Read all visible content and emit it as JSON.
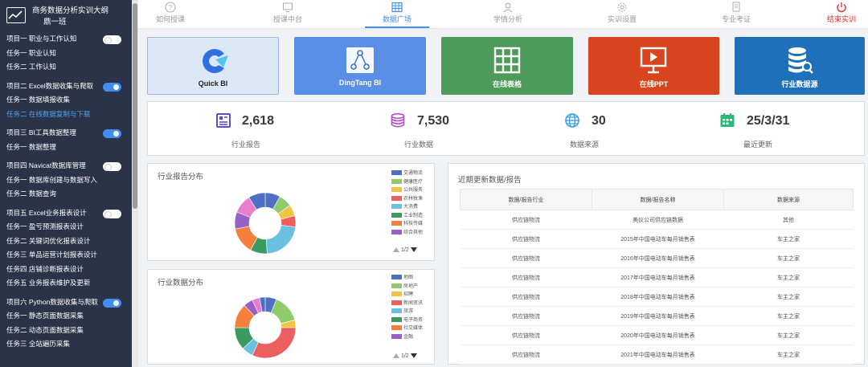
{
  "sidebar": {
    "title_line1": "商务数据分析实训大纲",
    "title_line2": "鼎一班",
    "projects": [
      {
        "label": "项目一 职业与工作认知",
        "on": false,
        "tasks": [
          {
            "label": "任务一 职业认知"
          },
          {
            "label": "任务二 工作认知"
          }
        ]
      },
      {
        "label": "项目二 Excel数据收集与爬取",
        "on": true,
        "tasks": [
          {
            "label": "任务一 数据填报收集"
          },
          {
            "label": "任务二 在线数据复制与下载",
            "active": true
          }
        ]
      },
      {
        "label": "项目三 BI工具数据整理",
        "on": true,
        "tasks": [
          {
            "label": "任务一 数据整理"
          }
        ]
      },
      {
        "label": "项目四 Navicat数据库管理",
        "on": false,
        "tasks": [
          {
            "label": "任务一 数据库创建与数据写入"
          },
          {
            "label": "任务二 数据查询"
          }
        ]
      },
      {
        "label": "项目五 Excel业务报表设计",
        "on": false,
        "tasks": [
          {
            "label": "任务一 盈亏预测报表设计"
          },
          {
            "label": "任务二 关键词优化报表设计"
          },
          {
            "label": "任务三 单品运营计划报表设计"
          },
          {
            "label": "任务四 店铺诊断报表设计"
          },
          {
            "label": "任务五 业务报表维护及更新"
          }
        ]
      },
      {
        "label": "项目六 Python数据收集与爬取",
        "on": true,
        "tasks": [
          {
            "label": "任务一 静态页面数据采集"
          },
          {
            "label": "任务二 动态页面数据采集"
          },
          {
            "label": "任务三 全站遍历采集"
          }
        ]
      }
    ]
  },
  "nav": {
    "tabs": [
      {
        "label": "如何授课",
        "icon": "question-circle-icon"
      },
      {
        "label": "授课中台",
        "icon": "monitor-icon"
      },
      {
        "label": "数据广场",
        "icon": "grid-table-icon",
        "active": true
      },
      {
        "label": "学情分析",
        "icon": "user-analysis-icon"
      },
      {
        "label": "实训设置",
        "icon": "gear-icon"
      },
      {
        "label": "专业考证",
        "icon": "certificate-icon"
      }
    ],
    "end_label": "结束实训"
  },
  "tiles": [
    {
      "label": "Quick BI",
      "color": "#dde8f7",
      "icon": "quickbi-logo-icon"
    },
    {
      "label": "DingTang BI",
      "color": "#5a8fe8",
      "icon": "share-nodes-icon"
    },
    {
      "label": "在线表格",
      "color": "#4d9a5a",
      "icon": "table-icon"
    },
    {
      "label": "在线PPT",
      "color": "#d9451e",
      "icon": "presentation-icon"
    },
    {
      "label": "行业数据源",
      "color": "#1e70b8",
      "icon": "database-search-icon"
    }
  ],
  "stats": [
    {
      "value": "2,618",
      "label": "行业报告",
      "color": "#5a4fcf",
      "icon": "report-icon"
    },
    {
      "value": "7,530",
      "label": "行业数据",
      "color": "#b24fc9",
      "icon": "database-icon"
    },
    {
      "value": "30",
      "label": "数据来源",
      "color": "#3aa0e0",
      "icon": "globe-icon"
    },
    {
      "value": "25/3/31",
      "label": "最近更新",
      "color": "#2db87a",
      "icon": "calendar-icon"
    }
  ],
  "report_dist": {
    "title": "行业报告分布",
    "pager": "1/2",
    "legend": [
      {
        "label": "交通物流",
        "color": "#4e6fc4"
      },
      {
        "label": "健康医疗",
        "color": "#8fcb6b"
      },
      {
        "label": "公共服务",
        "color": "#f5c342"
      },
      {
        "label": "农林牧渔",
        "color": "#ec5f5f"
      },
      {
        "label": "大消费",
        "color": "#6ac0e0"
      },
      {
        "label": "工业制造",
        "color": "#3a9a60"
      },
      {
        "label": "科技传媒",
        "color": "#f57f3c"
      },
      {
        "label": "综合其他",
        "color": "#9a5fc4"
      }
    ],
    "slices": [
      {
        "color": "#4e6fc4",
        "value": 8
      },
      {
        "color": "#8fcb6b",
        "value": 7
      },
      {
        "color": "#f5c342",
        "value": 6
      },
      {
        "color": "#ec5f5f",
        "value": 6
      },
      {
        "color": "#6ac0e0",
        "value": 22
      },
      {
        "color": "#3a9a60",
        "value": 9
      },
      {
        "color": "#f57f3c",
        "value": 14
      },
      {
        "color": "#9a5fc4",
        "value": 9
      },
      {
        "color": "#ea7ccc",
        "value": 10
      },
      {
        "color": "#4e6fc4",
        "value": 9
      }
    ]
  },
  "data_dist": {
    "title": "行业数据分布",
    "pager": "1/2",
    "legend": [
      {
        "label": "地图",
        "color": "#4e6fc4"
      },
      {
        "label": "房地产",
        "color": "#8fcb6b"
      },
      {
        "label": "招聘",
        "color": "#f5c342"
      },
      {
        "label": "新闻资讯",
        "color": "#ec5f5f"
      },
      {
        "label": "旅游",
        "color": "#6ac0e0"
      },
      {
        "label": "电子商务",
        "color": "#3a9a60"
      },
      {
        "label": "社交媒体",
        "color": "#f57f3c"
      },
      {
        "label": "金融",
        "color": "#9a5fc4"
      }
    ],
    "slices": [
      {
        "color": "#4e6fc4",
        "value": 6
      },
      {
        "color": "#8fcb6b",
        "value": 15
      },
      {
        "color": "#f5c342",
        "value": 4
      },
      {
        "color": "#ec5f5f",
        "value": 32
      },
      {
        "color": "#6ac0e0",
        "value": 6
      },
      {
        "color": "#3a9a60",
        "value": 12
      },
      {
        "color": "#f57f3c",
        "value": 13
      },
      {
        "color": "#9a5fc4",
        "value": 5
      },
      {
        "color": "#ea7ccc",
        "value": 4
      },
      {
        "color": "#4e6fc4",
        "value": 3
      }
    ]
  },
  "recent": {
    "title": "近期更新数据/报告",
    "headers": [
      "数据/报告行业",
      "数据/报告名称",
      "数据来源"
    ],
    "rows": [
      [
        "供应链物流",
        "美仪公司供应链数据",
        "其他"
      ],
      [
        "供应链物流",
        "2015年中国电动车每月销售表",
        "车主之家"
      ],
      [
        "供应链物流",
        "2016年中国电动车每月销售表",
        "车主之家"
      ],
      [
        "供应链物流",
        "2017年中国电动车每月销售表",
        "车主之家"
      ],
      [
        "供应链物流",
        "2018年中国电动车每月销售表",
        "车主之家"
      ],
      [
        "供应链物流",
        "2019年中国电动车每月销售表",
        "车主之家"
      ],
      [
        "供应链物流",
        "2020年中国电动车每月销售表",
        "车主之家"
      ],
      [
        "供应链物流",
        "2021年中国电动车每月销售表",
        "车主之家"
      ]
    ]
  }
}
